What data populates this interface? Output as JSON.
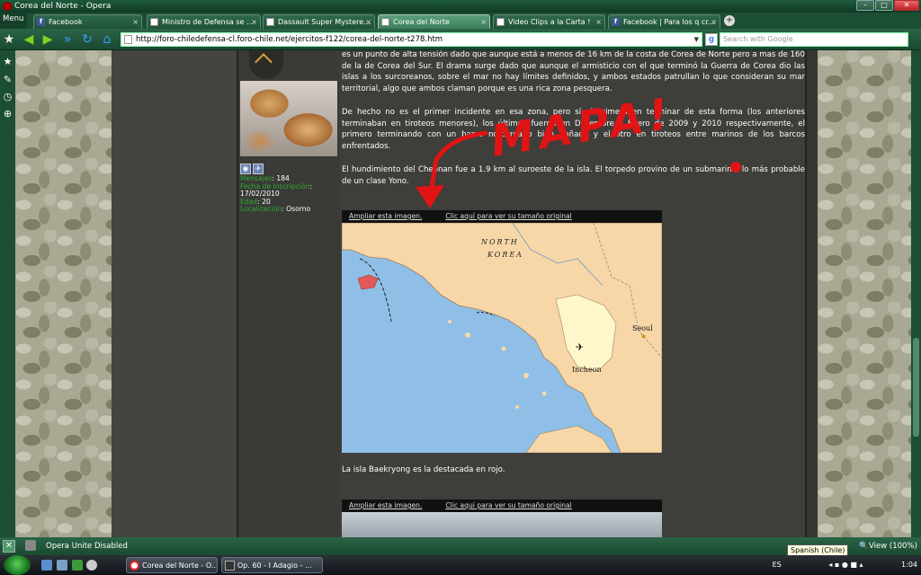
{
  "window": {
    "title": "Corea del Norte - Opera"
  },
  "menu": {
    "label": "Menu"
  },
  "tabs": [
    {
      "label": "Facebook",
      "icon": "facebook-icon"
    },
    {
      "label": "Ministro de Defensa se ...",
      "icon": "document-icon"
    },
    {
      "label": "Dassault Super Mystere...",
      "icon": "document-icon"
    },
    {
      "label": "Corea del Norte",
      "icon": "document-icon",
      "active": true
    },
    {
      "label": "Video Clips a la Carta !",
      "icon": "document-icon"
    },
    {
      "label": "Facebook | Para los q cr...",
      "icon": "facebook-icon"
    }
  ],
  "address": {
    "url": "http://foro-chiledefensa-cl.foro-chile.net/ejercitos-f122/corea-del-norte-t278.htm"
  },
  "search": {
    "placeholder": "Search with Google"
  },
  "profile": {
    "mensajes_label": "Mensajes",
    "mensajes_value": ": 184",
    "fecha_label": "Fecha de inscripción",
    "fecha_sep": ":",
    "fecha_value": "17/02/2010",
    "edad_label": "Edad",
    "edad_value": ": 20",
    "loc_label": "Localización",
    "loc_value": ": Osorno"
  },
  "post": {
    "p1": "es un punto de alta tensión dado que aunque está a menos de 16 km de la costa de Corea de Norte pero a mas de 160 de la de Corea del Sur. El drama surge dado que aunque el armisticio con el que terminó la Guerra de Corea dio las islas a los surcoreanos, sobre el mar no hay límites definidos, y ambos estados patrullan lo que consideran su mar territorial, algo que ambos claman porque es una rica zona pesquera.",
    "p2": "De hecho no es el primer incidente en esa zona, pero sí el primero en terminar de esta forma (los anteriores terminaban en tiroteos menores), los últimos fueron en Diciembre y Enero de 2009 y 2010 respectivamente, el primero terminando con un barco norcoreano bien dañado y el otro en tiroteos entre marinos de los barcos enfrentados.",
    "p3": "El hundimiento del Cheonan fue a 1.9 km al suroeste de la isla. El torpedo provino de un submarino, lo más probable de un clase Yono.",
    "caption": "La isla Baekryong es la destacada en rojo."
  },
  "image_links": {
    "enlarge": "Ampliar esta imagen.",
    "original": "Clic aquí para ver su tamaño original"
  },
  "map": {
    "region_label_1": "NORTH",
    "region_label_2": "KOREA",
    "city_1": "Seoul",
    "city_2": "Incheon"
  },
  "annotation": {
    "text": "MAPA!"
  },
  "statusbar": {
    "unite": "Opera Unite Disabled",
    "view": "View (100%)"
  },
  "tooltip": {
    "text": "Spanish (Chile)"
  },
  "taskbar": {
    "items": [
      {
        "label": "Corea del Norte - O..."
      },
      {
        "label": "Op. 60 - I Adagio - ..."
      }
    ],
    "lang": "ES",
    "clock": "1:04"
  },
  "colors": {
    "accent": "#1c4e34",
    "annotation": "#e01414",
    "label_green": "#2faa2f"
  }
}
